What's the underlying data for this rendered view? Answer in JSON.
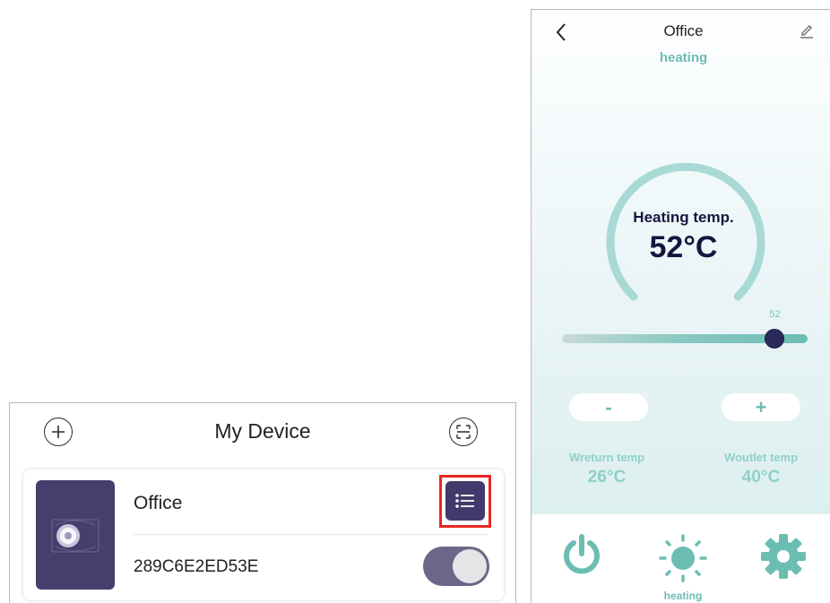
{
  "my_device": {
    "title": "My Device",
    "add_icon": "plus-circle-icon",
    "scan_icon": "scan-frame-icon",
    "device": {
      "name": "Office",
      "id": "289C6E2ED53E",
      "menu_icon": "list-icon",
      "highlight_color": "#e8261f",
      "power_on": true
    }
  },
  "thermostat": {
    "title": "Office",
    "mode": "heating",
    "gauge_label": "Heating temp.",
    "gauge_value": "52°C",
    "slider": {
      "value": 52,
      "min": 0,
      "max": 60,
      "value_label": "52"
    },
    "minus_label": "-",
    "plus_label": "+",
    "return_temp": {
      "label": "Wreturn temp",
      "value": "26°C"
    },
    "outlet_temp": {
      "label": "Woutlet temp",
      "value": "40°C"
    },
    "nav": {
      "power_icon": "power-icon",
      "heating_icon": "sun-icon",
      "heating_label": "heating",
      "settings_icon": "gear-icon"
    },
    "accent_color": "#6bbdb4",
    "dark_color": "#16153e"
  }
}
